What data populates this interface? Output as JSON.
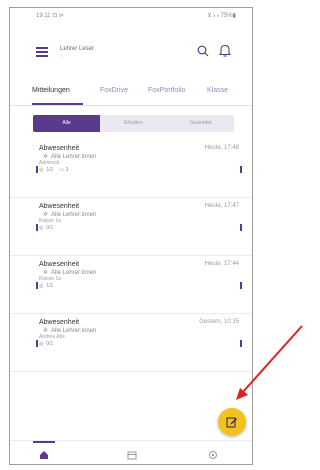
{
  "status_bar": {
    "time": "19:11 ⊡ ⊳",
    "icons": "⊻ ᵢₗ ᵢₗ 75%▮"
  },
  "header": {
    "user_name": "Lehrer Leser",
    "user_sub": "↓",
    "menu_icon": "menu-icon",
    "search_icon": "search-icon",
    "bell_icon": "bell-icon"
  },
  "tabs": [
    {
      "label": "Mitteilungen",
      "active": true
    },
    {
      "label": "FoxDrive",
      "active": false
    },
    {
      "label": "FoxPortfolio",
      "active": false
    },
    {
      "label": "Klasse",
      "active": false
    }
  ],
  "filters": [
    {
      "label": "Alle",
      "active": true
    },
    {
      "label": "Erhalten",
      "active": false
    },
    {
      "label": "Gesendet",
      "active": false
    }
  ],
  "messages": [
    {
      "title": "Abwesenheit",
      "time": "Heute, 17:48",
      "recipients": "Alle Lehrer:innen",
      "author": "Administr.",
      "views": "1/1",
      "comments": "3"
    },
    {
      "title": "Abwesenheit",
      "time": "Heute, 17:47",
      "recipients": "Alle Lehrer:innen",
      "author": "Klasse 1a",
      "views": "0/1",
      "comments": ""
    },
    {
      "title": "Abwesenheit",
      "time": "Heute, 17:44",
      "recipients": "Alle Lehrer:innen",
      "author": "Klasse 1a",
      "views": "1/1",
      "comments": ""
    },
    {
      "title": "Abwesenheit",
      "time": "Gestern, 10:15",
      "recipients": "Alle Lehrer:innen",
      "author": "Andrea Abs",
      "views": "0/1",
      "comments": ""
    }
  ],
  "fab": {
    "icon": "edit-icon"
  },
  "colors": {
    "primary": "#5a3a8e",
    "fab": "#f2c21d",
    "arrow": "#e02020"
  },
  "bottom_nav": [
    {
      "icon": "home-icon"
    },
    {
      "icon": "calendar-icon"
    },
    {
      "icon": "settings-icon"
    }
  ]
}
